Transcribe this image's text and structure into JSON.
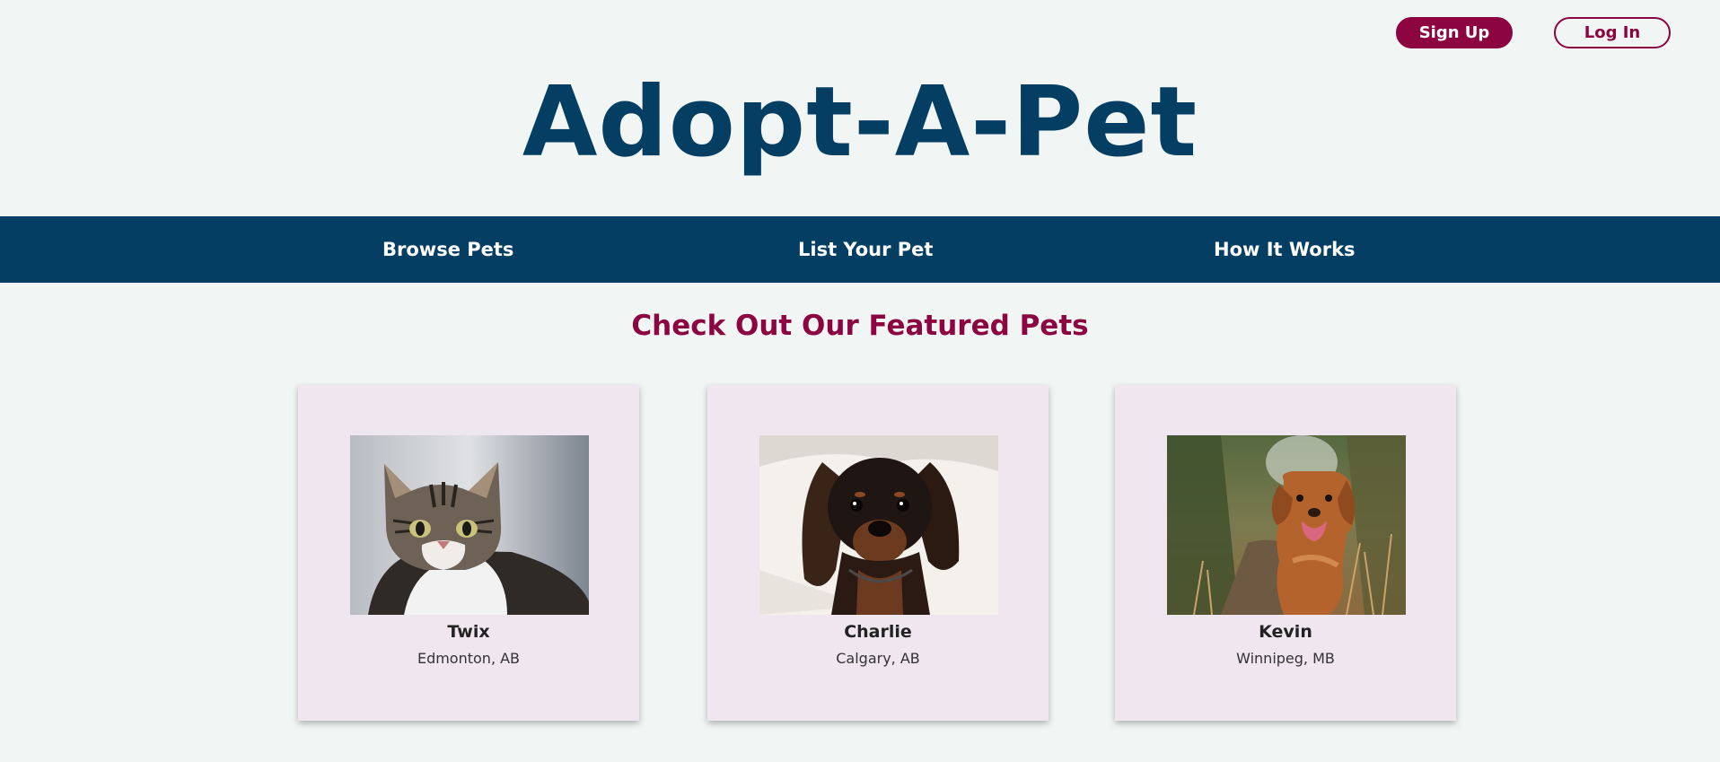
{
  "header": {
    "signup_label": "Sign Up",
    "login_label": "Log In",
    "logo_text": "Adopt-A-Pet"
  },
  "nav": {
    "items": [
      {
        "label": "Browse Pets"
      },
      {
        "label": "List Your Pet"
      },
      {
        "label": "How It Works"
      }
    ]
  },
  "featured": {
    "title": "Check Out Our Featured Pets",
    "pets": [
      {
        "name": "Twix",
        "location": "Edmonton, AB",
        "photo": "tabby-cat-photo"
      },
      {
        "name": "Charlie",
        "location": "Calgary, AB",
        "photo": "dachshund-photo"
      },
      {
        "name": "Kevin",
        "location": "Winnipeg, MB",
        "photo": "golden-dog-photo"
      }
    ]
  },
  "colors": {
    "background": "#f1f6f4",
    "brand_navy": "#043e63",
    "brand_maroon": "#8c0540",
    "card_bg": "#efe6ef"
  }
}
